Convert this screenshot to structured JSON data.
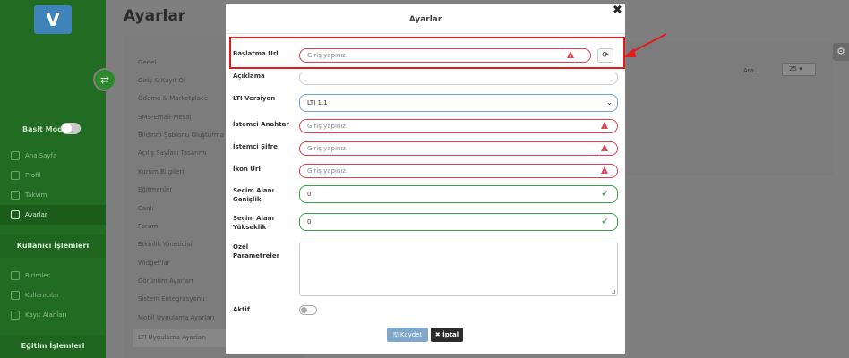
{
  "app": {
    "logo_letter": "V",
    "page_title": "Ayarlar"
  },
  "sidebar": {
    "basit_mod_label": "Basit Mod",
    "items": [
      {
        "label": "Ana Sayfa"
      },
      {
        "label": "Profil"
      },
      {
        "label": "Takvim"
      },
      {
        "label": "Ayarlar"
      }
    ],
    "section_users": "Kullanıcı İşlemleri",
    "user_items": [
      {
        "label": "Birimler"
      },
      {
        "label": "Kullanıcılar"
      },
      {
        "label": "Kayıt Alanları"
      }
    ],
    "section_education": "Eğitim İşlemleri"
  },
  "settings_menu": {
    "items": [
      "Genel",
      "Giriş & Kayıt Ol",
      "Ödeme & Marketplace",
      "SMS-Email-Mesaj",
      "Bildirim Şablonu Oluşturma",
      "Açılış Sayfası Tasarımı",
      "Kurum Bilgileri",
      "Eğitmenler",
      "Canlı",
      "Forum",
      "Etkinlik Yöneticisi",
      "Widget'lar",
      "Görünüm Ayarları",
      "Sistem Entegrasyonu",
      "Mobil Uygulama Ayarları",
      "LTI Uygulama Ayarları"
    ]
  },
  "table_controls": {
    "search_label": "Ara...",
    "page_size": "25 ▾"
  },
  "modal": {
    "title": "Ayarlar",
    "close_glyph": "✖",
    "fields": {
      "baslatma_url": {
        "label": "Başlatma Url",
        "placeholder": "Giriş yapınız."
      },
      "aciklama": {
        "label": "Açıklama",
        "value": ""
      },
      "lti_versiyon": {
        "label": "LTI Versiyon",
        "value": "LTI 1.1"
      },
      "istemci_anahtar": {
        "label": "İstemci Anahtar",
        "placeholder": "Giriş yapınız."
      },
      "istemci_sifre": {
        "label": "İstemci Şifre",
        "placeholder": "Giriş yapınız."
      },
      "ikon_url": {
        "label": "İkon Url",
        "placeholder": "Giriş yapınız."
      },
      "secim_genislik": {
        "label": "Seçim Alanı Genişlik",
        "value": "0"
      },
      "secim_yukseklik": {
        "label": "Seçim Alanı Yükseklik",
        "value": "0"
      },
      "ozel_parametreler": {
        "label": "Özel Parametreler",
        "value": ""
      },
      "aktif": {
        "label": "Aktif"
      }
    },
    "buttons": {
      "save": "🖫 Kaydet",
      "cancel": "✖ İptal"
    }
  },
  "colors": {
    "error": "#e04050",
    "success": "#3aa04a",
    "highlight": "#e21b1b",
    "sidebar": "#226b22"
  }
}
